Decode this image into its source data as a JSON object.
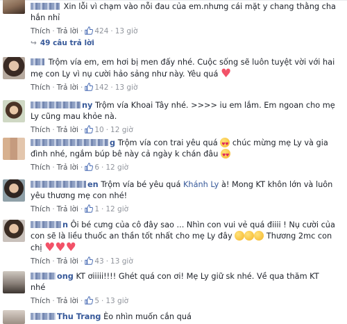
{
  "comments": [
    {
      "text": "Xin lỗi vì chạm vào nỗi đau của em.nhưng cái mặt y chang thằng cha hắn nhỉ",
      "actions": {
        "like": "Thích",
        "reply": "Trả lời",
        "count": "424",
        "time": "13 giờ"
      },
      "replies": "49 câu trả lời"
    },
    {
      "text": "Trộm vía em, em hơi bị men đấy nhé. Cuộc sống sẽ luôn tuyệt vời với hai mẹ con Ly vì nụ cười hảo sảng như này. Yêu quá",
      "actions": {
        "like": "Thích",
        "reply": "Trả lời",
        "count": "142",
        "time": "13 giờ"
      }
    },
    {
      "name_part": "ny",
      "text": "Trộm vía Khoai Tây nhé. >>>> iu em lắm. Em ngoan cho mẹ Ly cũng mau khỏe nà.",
      "actions": {
        "like": "Thích",
        "reply": "Trả lời",
        "count": "10",
        "time": "12 giờ"
      }
    },
    {
      "name_part": "g",
      "text_a": "Trộm vía con trai yêu quá",
      "text_b": "chúc mừng mẹ Ly và gia đình nhé, ngắm búp bê này cả ngày k chán đâu",
      "actions": {
        "like": "Thích",
        "reply": "Trả lời",
        "count": "6",
        "time": "12 giờ"
      }
    },
    {
      "name_part": "en",
      "text_a": "Trộm vía bé yêu quá",
      "mention": "Khánh Ly",
      "text_b": "à! Mong KT khôn lớn và luôn yêu thương mẹ con nhé!",
      "actions": {
        "like": "Thích",
        "reply": "Trả lời",
        "count": "1",
        "time": "12 giờ"
      }
    },
    {
      "name_part": "n",
      "text_a": "Ôi bé cưng của cô đây sao ... Nhìn con vui vẻ quá điiii ! Nụ cười của con sẽ là liều thuốc an thần tốt nhất cho mẹ Ly đây",
      "text_b": "Thương 2mc con chị",
      "actions": {
        "like": "Thích",
        "reply": "Trả lời",
        "count": "43",
        "time": "13 giờ"
      }
    },
    {
      "name_part": "ong",
      "text": "KT ơiiiii!!!! Ghét quá con ơi! Mẹ Ly giữ sk nhé. Về qua thăm KT nhé",
      "actions": {
        "like": "Thích",
        "reply": "Trả lời",
        "count": "5",
        "time": "13 giờ"
      }
    },
    {
      "name": "Thu Trang",
      "text": "Èo nhìn muốn cắn quá"
    }
  ],
  "icons": {
    "like": "thumbs-up-icon",
    "reply_arrow": "reply-arrow-icon",
    "heart": "heart-icon",
    "emoji": "emoji-icon"
  },
  "colors": {
    "link": "#365899",
    "meta": "#90949c",
    "like_blue": "#4267b2",
    "heart": "#f25268"
  }
}
